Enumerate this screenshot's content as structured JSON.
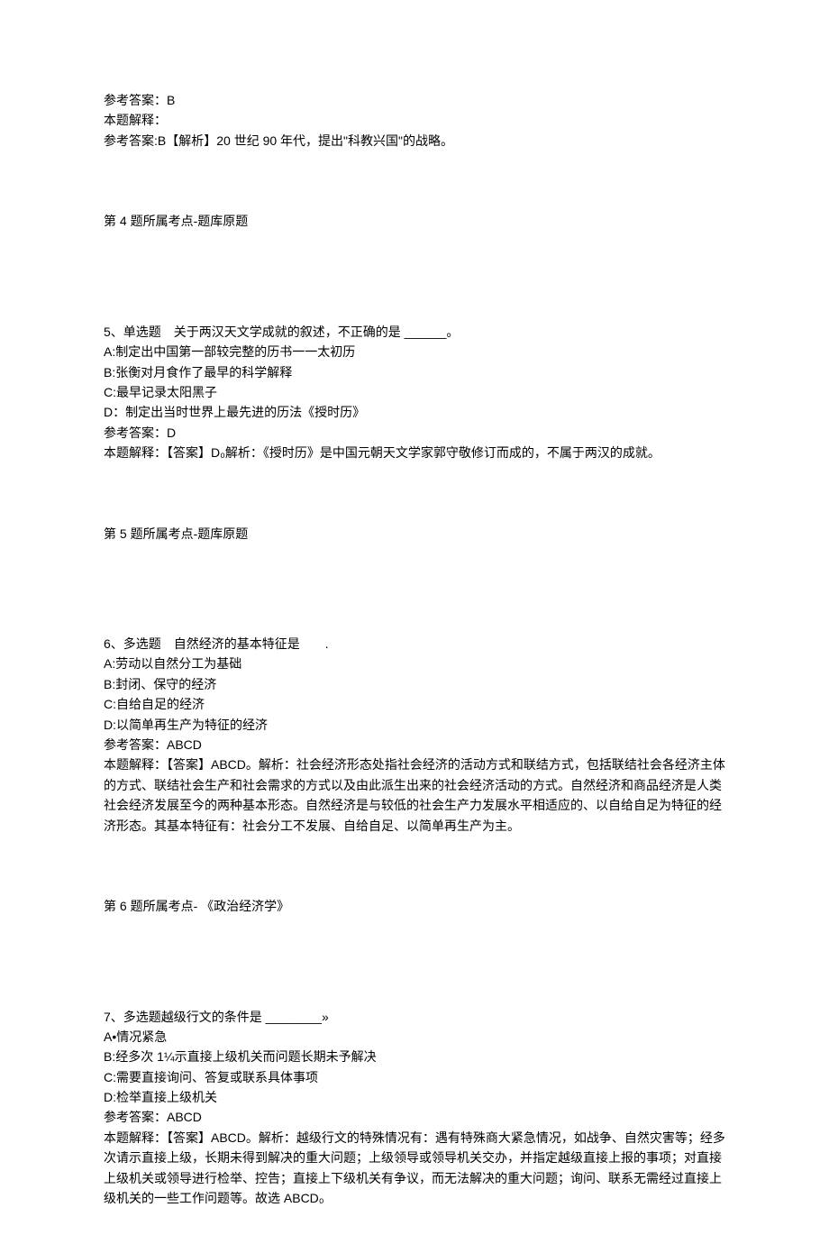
{
  "q3_tail": {
    "ref_ans_label": "参考答案：",
    "ref_ans_value": "B",
    "expl_label": "本题解释：",
    "expl_text": "参考答案:B【解析】20 世纪 90 年代，提出\"科教兴国\"的战略。",
    "topic": "第 4 题所属考点-题库原题"
  },
  "q5": {
    "header": "5、单选题 关于两汉天文学成就的叙述，不正确的是 ______。",
    "optA": "A:制定出中国第一部较完整的历书一一太初历",
    "optB": "B:张衡对月食作了最早的科学解释",
    "optC": "C:最早记录太阳黑子",
    "optD": "D：制定出当时世界上最先进的历法《授时历》",
    "ref_ans_label": "参考答案：",
    "ref_ans_value": "D",
    "expl_text": "本题解释：【答案】D₀解析：《授时历》是中国元朝天文学家郭守敬修订而成的，不属于两汉的成就。",
    "topic": "第 5 题所属考点-题库原题"
  },
  "q6": {
    "header": "6、多选题 自然经济的基本特征是  .",
    "optA": "A:劳动以自然分工为基础",
    "optB": "B:封闭、保守的经济",
    "optC": "C:自给自足的经济",
    "optD": "D:以简单再生产为特征的经济",
    "ref_ans_label": "参考答案：",
    "ref_ans_value": "ABCD",
    "expl_text": "本题解释：【答案】ABCD。解析：社会经济形态处指社会经济的活动方式和联结方式，包括联结社会各经济主体的方式、联结社会生产和社会需求的方式以及由此派生出来的社会经济活动的方式。自然经济和商品经济是人类社会经济发展至今的两种基本形态。自然经济是与较低的社会生产力发展水平相适应的、以自给自足为特征的经济形态。其基本特征有：社会分工不发展、自给自足、以简单再生产为主。",
    "topic": "第 6 题所属考点- 《政治经济学》"
  },
  "q7": {
    "header": "7、多选题越级行文的条件是 ________»",
    "optA": "A•情况紧急",
    "optB": "B:经多次 1¼示直接上级机关而问题长期未予解决",
    "optC": "C:需要直接询问、答复或联系具体事项",
    "optD": "D:检举直接上级机关",
    "ref_ans_label": "参考答案：",
    "ref_ans_value": "ABCD",
    "expl_text": "本题解释：【答案】ABCD。解析：越级行文的特殊情况有：遇有特殊商大紧急情况，如战争、自然灾害等；经多次请示直接上级，长期未得到解决的重大问题；上级领导或领导机关交办，并指定越级直接上报的事项；对直接上级机关或领导进行检举、控告；直接上下级机关有争议，而无法解决的重大问题；询问、联系无需经过直接上级机关的一些工作问题等。故选 ABCD₀"
  }
}
